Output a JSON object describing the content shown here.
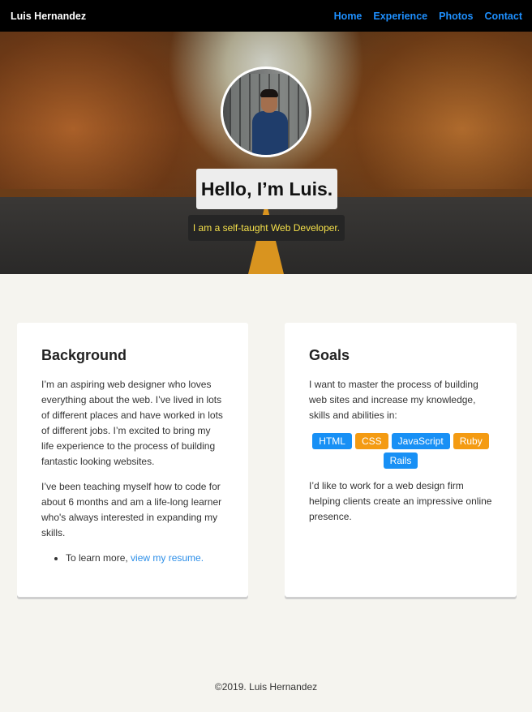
{
  "nav": {
    "brand": "Luis Hernandez",
    "links": [
      "Home",
      "Experience",
      "Photos",
      "Contact"
    ]
  },
  "hero": {
    "title": "Hello, I’m Luis.",
    "subtitle": "I am a self-taught Web Developer."
  },
  "background_card": {
    "heading": "Background",
    "para1": "I’m an aspiring web designer who loves everything about the web. I’ve lived in lots of different places and have worked in lots of different jobs. I’m excited to bring my life experience to the process of building fantastic looking websites.",
    "para2": "I’ve been teaching myself how to code for about 6 months and am a life-long learner who's always interested in expanding my skills.",
    "bullet_prefix": "To learn more, ",
    "bullet_link": "view my resume."
  },
  "goals_card": {
    "heading": "Goals",
    "para1": "I want to master the process of building web sites and increase my knowledge, skills and abilities in:",
    "tags": [
      {
        "label": "HTML",
        "color": "#1890f5"
      },
      {
        "label": "CSS",
        "color": "#f49b12"
      },
      {
        "label": "JavaScript",
        "color": "#1890f5"
      },
      {
        "label": "Ruby",
        "color": "#f49b12"
      },
      {
        "label": "Rails",
        "color": "#1890f5"
      }
    ],
    "para2": "I’d like to work for a web design firm helping clients create an impressive online presence."
  },
  "footer": {
    "text": "©2019. Luis Hernandez"
  },
  "colors": {
    "nav_bg": "#000000",
    "nav_link": "#1e90ff",
    "page_bg": "#f5f4ef",
    "subtitle_text": "#f5e04a",
    "link": "#2b8ee8"
  }
}
